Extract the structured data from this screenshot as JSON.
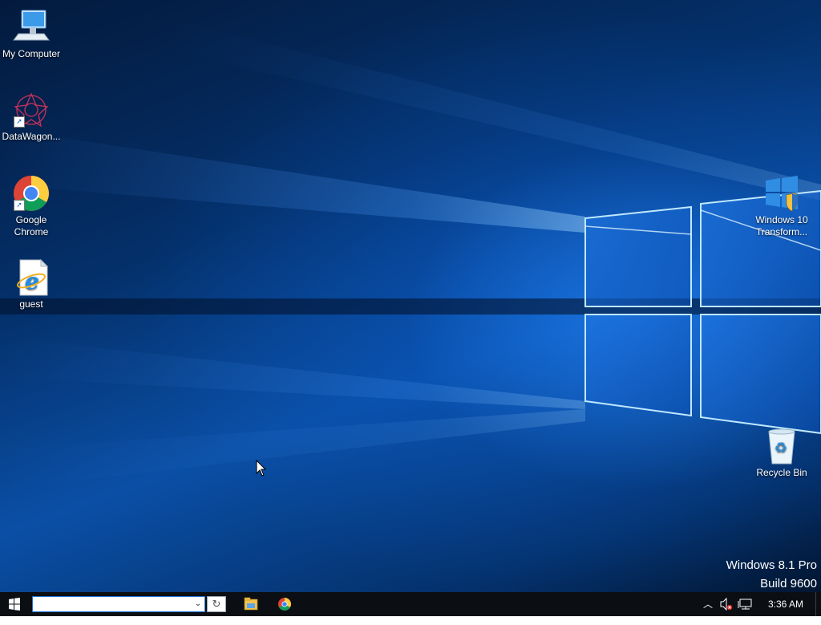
{
  "desktop": {
    "icons": [
      {
        "label": "My Computer",
        "icon": "computer-icon"
      },
      {
        "label": "DataWagon...",
        "icon": "datawagon-icon"
      },
      {
        "label": "Google Chrome",
        "icon": "chrome-icon"
      },
      {
        "label": "guest",
        "icon": "internet-explorer-icon"
      },
      {
        "label": "Windows 10 Transform...",
        "icon": "windows-10-transformation-icon"
      },
      {
        "label": "Recycle Bin",
        "icon": "recycle-bin-icon"
      }
    ],
    "watermark": {
      "line1": "Windows 8.1 Pro",
      "line2": "Build 9600"
    }
  },
  "taskbar": {
    "address_value": "",
    "pinned": [
      {
        "icon": "file-explorer-icon"
      },
      {
        "icon": "chrome-icon"
      }
    ],
    "tray": {
      "icons": [
        "show-hidden-icons-chevron",
        "speaker-muted-icon",
        "network-icon"
      ],
      "clock": "3:36 AM"
    }
  },
  "colors": {
    "taskbar_bg": "#0b0f14",
    "accent_blue": "#1e73d8",
    "wallpaper_glow": "#3aa0ff"
  }
}
